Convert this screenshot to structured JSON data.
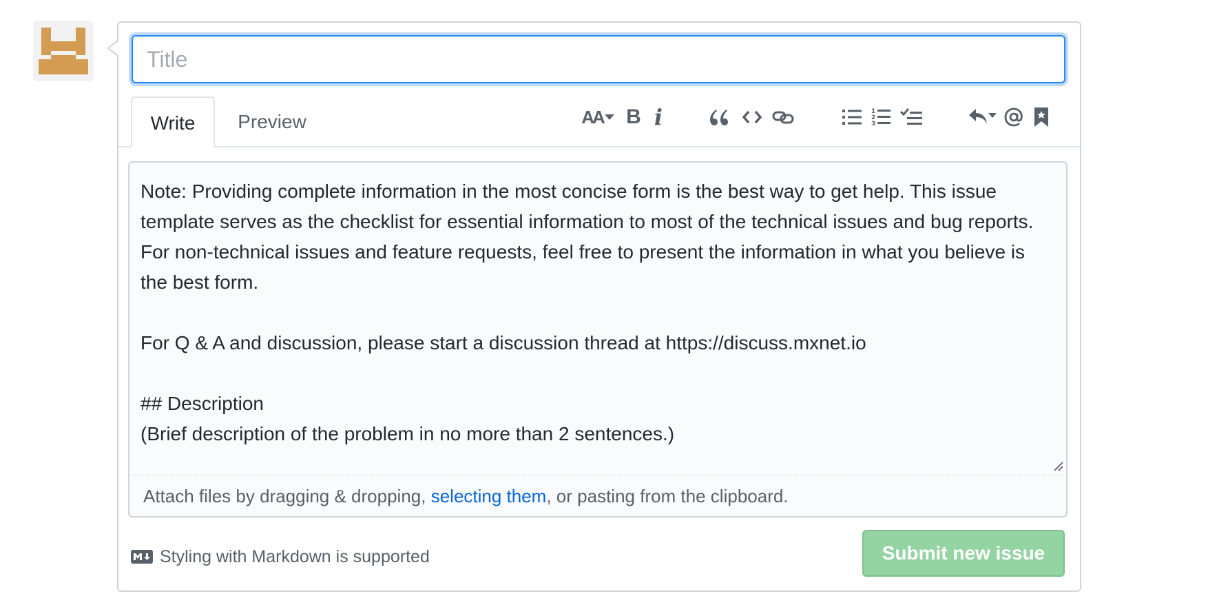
{
  "title_input": {
    "placeholder": "Title",
    "value": ""
  },
  "tabs": [
    {
      "label": "Write",
      "active": true
    },
    {
      "label": "Preview",
      "active": false
    }
  ],
  "toolbar": {
    "header_text_label": "AA",
    "bold_label": "B",
    "italic_label": "i",
    "icons": [
      "header-icon",
      "bold-icon",
      "italic-icon",
      "quote-icon",
      "code-icon",
      "link-icon",
      "bulleted-list-icon",
      "numbered-list-icon",
      "task-list-icon",
      "reply-icon",
      "mention-icon",
      "bookmark-icon"
    ]
  },
  "body_text": "Note: Providing complete information in the most concise form is the best way to get help. This issue template serves as the checklist for essential information to most of the technical issues and bug reports. For non-technical issues and feature requests, feel free to present the information in what you believe is the best form.\n\nFor Q & A and discussion, please start a discussion thread at https://discuss.mxnet.io\n\n## Description\n(Brief description of the problem in no more than 2 sentences.)",
  "attach": {
    "prefix": "Attach files by dragging & dropping, ",
    "link": "selecting them",
    "suffix": ", or pasting from the clipboard."
  },
  "markdown_note": "Styling with Markdown is supported",
  "submit_label": "Submit new issue",
  "colors": {
    "accent": "#2188ff",
    "link": "#0366d6",
    "submit_bg": "#94d3a2",
    "avatar": "#d39c52"
  }
}
